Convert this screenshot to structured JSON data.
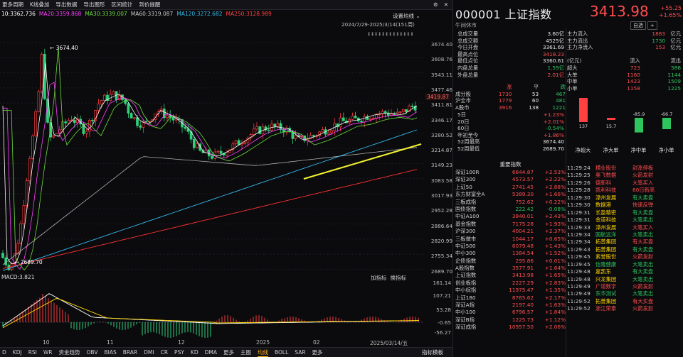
{
  "toolbar": {
    "items": [
      "更多周期",
      "K线叠加",
      "导出数据",
      "导出图形",
      "区间统计",
      "到价提醒"
    ]
  },
  "ma_line": [
    {
      "text": "10:3362.736",
      "color": "#ffffff"
    },
    {
      "text": "MA20:3359.868",
      "color": "#ff40ff"
    },
    {
      "text": "MA30:3339.007",
      "color": "#6ddc3e"
    },
    {
      "text": "MA60:3319.087",
      "color": "#c8c8c8"
    },
    {
      "text": "MA120:3272.682",
      "color": "#34b8e8"
    },
    {
      "text": "MA250:3128.989",
      "color": "#ff4040"
    }
  ],
  "chart_settings_label": "设置均线",
  "range_label": "2024/7/29-2025/3/14(151周)",
  "y_ticks": [
    "3674.40",
    "3608.76",
    "3543.11",
    "3477.46",
    "3411.81",
    "3346.17",
    "3280.52",
    "3214.87",
    "3149.23",
    "3083.58",
    "3017.93",
    "2952.28",
    "2886.64",
    "2820.99",
    "2755.34",
    "2689.70"
  ],
  "current_price_tag": "3419.87",
  "high_label": "3674.40",
  "low_label": "2689.70",
  "macd_label": "MACD:3.821",
  "macd_buttons": [
    "加指标",
    "换指标"
  ],
  "macd_ticks": [
    "161.14",
    "107.21",
    "53.28",
    "-0.65",
    "-56.27"
  ],
  "x_axis": [
    "10",
    "11",
    "12",
    "2025",
    "02"
  ],
  "date_box": "2025/03/14/五",
  "bottom_tabs": [
    "D",
    "KDJ",
    "RSI",
    "WR",
    "资金趋势",
    "OBV",
    "BIAS",
    "BRAR",
    "DMI",
    "CR",
    "PSY",
    "KD",
    "DMA",
    "更多",
    "主图",
    "均线",
    "BOLL",
    "SAR",
    "更多"
  ],
  "bottom_active": "均线",
  "bottom_right": "指标模板",
  "title": {
    "code": "000001",
    "name": "上证指数",
    "sub": "午间休市"
  },
  "price": "3413.98",
  "change": "+55.25",
  "change_pct": "+1.65%",
  "buttons": [
    "自选",
    "+"
  ],
  "quote": [
    {
      "label": "总成交量",
      "value": "3.60亿",
      "cls": "white"
    },
    {
      "label": "总成交额",
      "value": "4525亿",
      "cls": "white"
    },
    {
      "label": "今日开盘",
      "value": "3361.69",
      "cls": "white"
    },
    {
      "label": "最高点位",
      "value": "3418.23",
      "cls": "red"
    },
    {
      "label": "最低点位",
      "value": "3360.61",
      "cls": "white"
    },
    {
      "label": "内盘总量",
      "value": "1.59亿",
      "cls": "green"
    },
    {
      "label": "外盘总量",
      "value": "2.01亿",
      "cls": "red"
    }
  ],
  "breadth_header": [
    "",
    "涨",
    "平",
    "跌"
  ],
  "breadth": [
    [
      "成分股",
      "1730",
      "53",
      "467"
    ],
    [
      "沪全市",
      "1779",
      "60",
      "481"
    ],
    [
      "A股市",
      "3916",
      "138",
      "1221"
    ]
  ],
  "perf": [
    {
      "label": "5日",
      "value": "+1.23%",
      "cls": "red"
    },
    {
      "label": "20日",
      "value": "+2.01%",
      "cls": "red"
    },
    {
      "label": "60日",
      "value": "-0.54%",
      "cls": "green"
    },
    {
      "label": "年初至今",
      "value": "+1.86%",
      "cls": "red"
    },
    {
      "label": "52周最高",
      "value": "3674.40",
      "cls": "white"
    },
    {
      "label": "52周最低",
      "value": "2689.70",
      "cls": "white"
    }
  ],
  "flows": [
    {
      "label": "主力流入",
      "value": "1883",
      "unit": "亿元",
      "cls": "red"
    },
    {
      "label": "主力流出",
      "value": "1730",
      "unit": "亿元",
      "cls": "green"
    },
    {
      "label": "主力净流入",
      "value": "153",
      "unit": "亿元",
      "cls": "red"
    }
  ],
  "flow_table_header": [
    "(亿元)",
    "流入",
    "流出"
  ],
  "flow_table": [
    [
      "超大",
      "723",
      "586"
    ],
    [
      "大单",
      "1160",
      "1144"
    ],
    [
      "中单",
      "1423",
      "1509"
    ],
    [
      "小单",
      "1158",
      "1225"
    ]
  ],
  "net_bars": [
    {
      "name": "净超大",
      "value": 137,
      "label": "137"
    },
    {
      "name": "净大单",
      "value": 15.7,
      "label": "15.7"
    },
    {
      "name": "净中单",
      "value": -85.9,
      "label": "-85.9"
    },
    {
      "name": "净小单",
      "value": -66.7,
      "label": "-66.7"
    }
  ],
  "index_title": "重要指数",
  "indices": [
    [
      "深证100R",
      "6644.87",
      "+2.53%",
      "red"
    ],
    [
      "深证300",
      "4573.57",
      "+2.22%",
      "red"
    ],
    [
      "上证50",
      "2741.45",
      "+2.88%",
      "red"
    ],
    [
      "东方财富全A",
      "5389.30",
      "+1.66%",
      "red"
    ],
    [
      "三板成指",
      "752.62",
      "+0.22%",
      "red"
    ],
    [
      "国债指数",
      "222.42",
      "-0.08%",
      "green"
    ],
    [
      "中证A100",
      "3840.01",
      "+2.43%",
      "red"
    ],
    [
      "基金指数",
      "7175.28",
      "+1.93%",
      "red"
    ],
    [
      "沪深300",
      "4004.21",
      "+2.37%",
      "red"
    ],
    [
      "三板做市",
      "1044.17",
      "+0.65%",
      "red"
    ],
    [
      "中证500",
      "6079.48",
      "+1.43%",
      "red"
    ],
    [
      "中小300",
      "1384.54",
      "+1.52%",
      "red"
    ],
    [
      "企债指数",
      "295.86",
      "+0.01%",
      "red"
    ],
    [
      "A股指数",
      "3577.91",
      "+1.64%",
      "red"
    ],
    [
      "上证指数",
      "3413.98",
      "+1.65%",
      "red"
    ],
    [
      "创业板指",
      "2227.29",
      "+2.83%",
      "red"
    ],
    [
      "中小综指",
      "11975.47",
      "+1.35%",
      "red"
    ],
    [
      "上证180",
      "8765.62",
      "+2.17%",
      "red"
    ],
    [
      "深证A指",
      "2197.40",
      "+1.63%",
      "red"
    ],
    [
      "中小100",
      "6796.57",
      "+1.84%",
      "red"
    ],
    [
      "深证B指",
      "1225.73",
      "+1.12%",
      "red"
    ],
    [
      "深证成指",
      "10957.50",
      "+2.06%",
      "red"
    ]
  ],
  "ticks": [
    [
      "11:29:24",
      "横业股份",
      "封涨停板",
      "red",
      "red"
    ],
    [
      "11:29:25",
      "奥飞数据",
      "火箭发射",
      "red",
      "red"
    ],
    [
      "11:29:26",
      "德新科",
      "大笔买入",
      "red",
      "red"
    ],
    [
      "11:29:28",
      "凯利科技",
      "60日新高",
      "red",
      "red"
    ],
    [
      "11:29:30",
      "漳州发展",
      "有大卖盘",
      "yellow",
      "green"
    ],
    [
      "11:29:30",
      "数据港",
      "快速反弹",
      "yellow",
      "red"
    ],
    [
      "11:29:31",
      "长盈精密",
      "有大卖盘",
      "yellow",
      "green"
    ],
    [
      "11:29:31",
      "金道科技",
      "大笔卖出",
      "yellow",
      "green"
    ],
    [
      "11:29:33",
      "漳州发展",
      "大笔买入",
      "yellow",
      "red"
    ],
    [
      "11:29:34",
      "国航远洋",
      "大笔卖出",
      "green",
      "green"
    ],
    [
      "11:29:34",
      "拓普集团",
      "有大买盘",
      "yellow",
      "red"
    ],
    [
      "11:29:43",
      "拓普集团",
      "有大卖盘",
      "yellow",
      "green"
    ],
    [
      "11:29:45",
      "素誉股份",
      "火箭发射",
      "yellow",
      "red"
    ],
    [
      "11:29:45",
      "信隆健康",
      "大笔卖出",
      "green",
      "green"
    ],
    [
      "11:29:48",
      "嘉凯东",
      "有大卖盘",
      "yellow",
      "green"
    ],
    [
      "11:29:48",
      "兴龙集团",
      "大笔卖出",
      "yellow",
      "green"
    ],
    [
      "11:29:49",
      "广道数字",
      "火箭发射",
      "red",
      "red"
    ],
    [
      "11:29:49",
      "东华测试",
      "大笔卖出",
      "green",
      "green"
    ],
    [
      "11:29:52",
      "拓普集团",
      "有大买盘",
      "yellow",
      "red"
    ],
    [
      "11:29:52",
      "浙江荣泰",
      "火箭发射",
      "red",
      "red"
    ]
  ]
}
